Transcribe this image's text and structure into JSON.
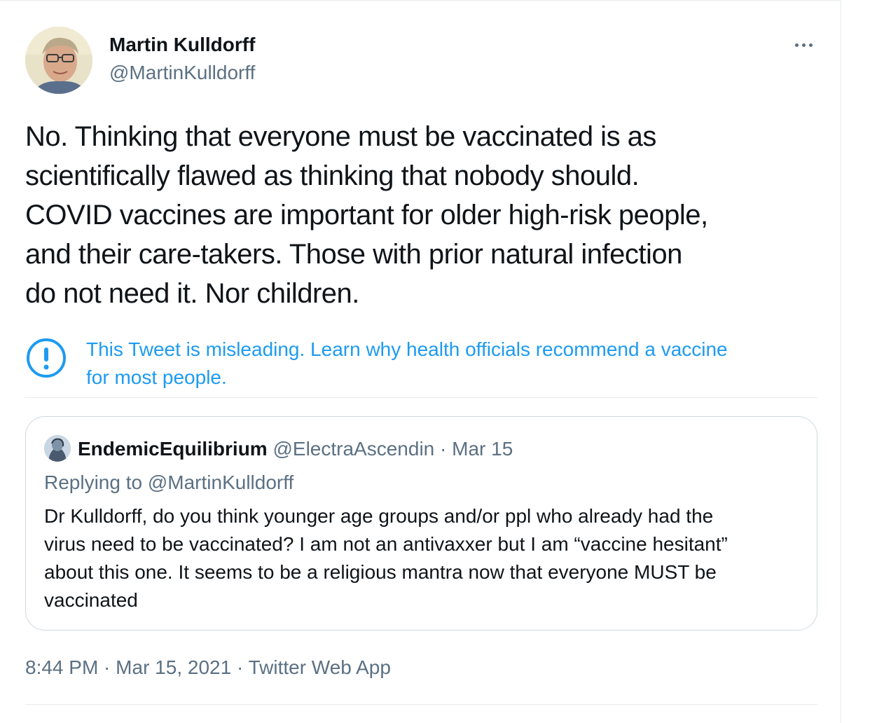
{
  "tweet": {
    "author_name": "Martin Kulldorff",
    "author_handle": "@MartinKulldorff",
    "more_icon": "ellipsis-icon",
    "text_lines": [
      "No. Thinking that everyone must be vaccinated is as",
      "scientifically flawed as thinking that nobody should.",
      "COVID vaccines are important for older high-risk people,",
      "and their care-takers. Those with prior natural infection",
      "do not need it. Nor children."
    ]
  },
  "misleading_notice": {
    "icon": "exclamation-circle-icon",
    "text_lines": [
      "This Tweet is misleading. Learn why health officials recommend a vaccine",
      "for most people."
    ]
  },
  "quoted_tweet": {
    "author_name": "EndemicEquilibrium",
    "author_handle": "@ElectraAscendin",
    "separator": " · ",
    "date": "Mar 15",
    "replying_to": "Replying to @MartinKulldorff",
    "text_lines": [
      "Dr Kulldorff, do you think younger age groups and/or ppl who already had the",
      "virus need to be vaccinated? I am not an antivaxxer but I am “vaccine hesitant”",
      "about this one. It seems to be a religious mantra now that everyone MUST be",
      "vaccinated"
    ]
  },
  "footer": {
    "time": "8:44 PM",
    "separator": " · ",
    "date": "Mar 15, 2021",
    "source": "Twitter Web App"
  },
  "colors": {
    "link_blue": "#1d9bf0",
    "secondary_text": "#5b7083",
    "primary_text": "#0f1419",
    "border": "#cfd9de"
  }
}
